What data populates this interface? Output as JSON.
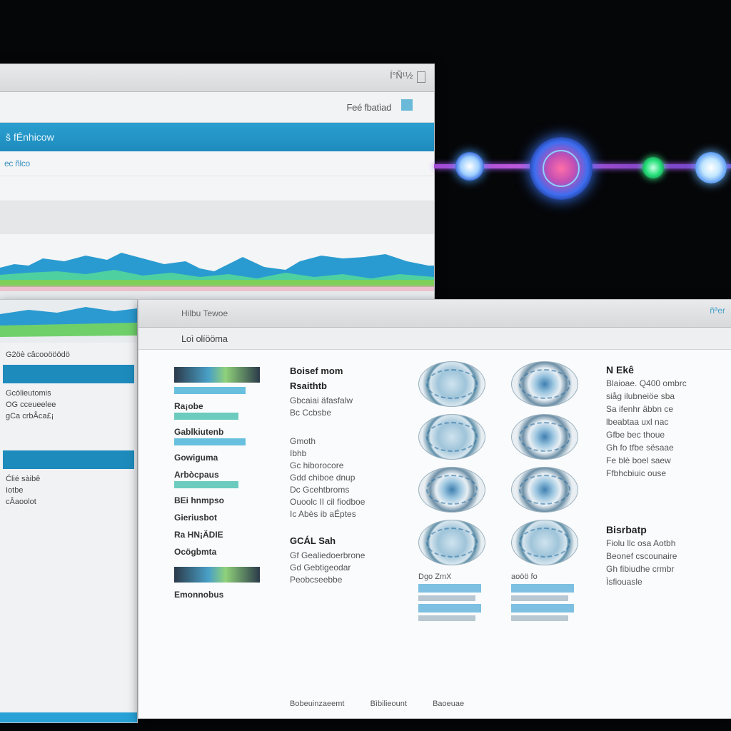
{
  "window_back": {
    "title_right": "Í°Ñ¹½",
    "toolbar_text": "Feé fbatìad",
    "bluebar_label": "š fÉnhicow",
    "row1_text": "ec ñlco"
  },
  "window_left": {
    "lines": [
      "G2öè câcooööödö",
      "Gcòlieutomis",
      "OG cceueelee",
      "gCa crbÂca£¡",
      "Ćlié sàibê",
      "Iotbe",
      "cÂaoolot"
    ]
  },
  "window_main": {
    "titlebar_left": "Hilbu Tewoe",
    "titlebar_right": "ñªer",
    "tab_text": "Loì olíööma",
    "col1_items": [
      "Ra¡obe",
      "Gablkiutenb",
      "Gowiguma",
      "Arbòcpaus",
      "BEi hnmpso",
      "Gieriusbot",
      "Ra HN¡ÄDIE",
      "Ocögbmta"
    ],
    "col1_bottom": "Emonnobus",
    "col2_heading": "Boisef mom",
    "col2_sub": "Rsaithtb",
    "col2_lines": [
      "Gbcaiai äfasfalw",
      "Bc Ccbsbe",
      "Gmoth",
      "Ibhb",
      "Gc hiborocore",
      "Gdd chiboe dnup",
      "Dc Gcehtbroms",
      "Ouoolc II cil fiodboe",
      "Ic Abès ib aÉptes"
    ],
    "col2_heading2": "GCÁL Sah",
    "col2_lines2": [
      "Gf Gealiedoerbrone",
      "Gd Gebtigeodar",
      "Peobcseebbe"
    ],
    "gadget_col_a_label": "Dgo ZmX",
    "gadget_col_b_label": "aoöö fo",
    "col5_heading": "N Ekê",
    "col5_lines": [
      "Blaioae. Q400 ombrc",
      "siåg ilubneiöe sba",
      "Sa ifenhr äbbn ce",
      "lbeabtaa uxl nac",
      "Gfbe bec thoue",
      "Gh fo tfbe sësaae",
      "Fe blè boel saew",
      "Ffbhcbiuic ouse"
    ],
    "col5_heading2": "Bisrbatp",
    "col5_lines2": [
      "Fiolu llc osa Aotbh",
      "Beonef cscounaire",
      "Gh fibiudhe crmbr",
      "Ìsfiouasle"
    ],
    "bottom_labels": [
      "Bobeuinzaeemt",
      "Bìbilieount",
      "Baoeuae"
    ]
  },
  "media_player": {
    "track_color": "#b050d8",
    "orbs": [
      "blue-orb",
      "main-orb",
      "green-orb",
      "white-orb"
    ]
  },
  "colors": {
    "accent_blue": "#1e8bbd",
    "teal": "#2fb7a5",
    "background": "#050608"
  }
}
